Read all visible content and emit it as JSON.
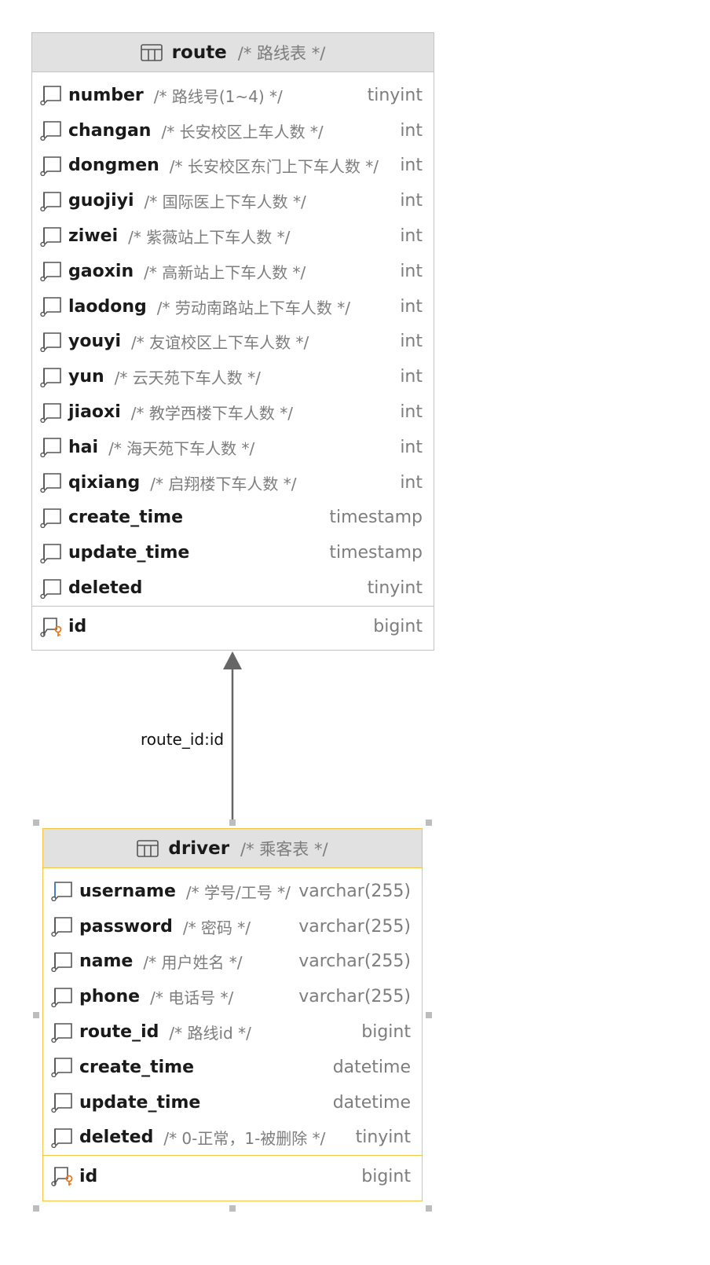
{
  "route": {
    "name": "route",
    "comment": "/* 路线表 */",
    "columns": [
      {
        "name": "number",
        "comment": "/* 路线号(1~4) */",
        "type": "tinyint"
      },
      {
        "name": "changan",
        "comment": "/* 长安校区上车人数 */",
        "type": "int"
      },
      {
        "name": "dongmen",
        "comment": "/* 长安校区东门上下车人数 */",
        "type": "int"
      },
      {
        "name": "guojiyi",
        "comment": "/* 国际医上下车人数 */",
        "type": "int"
      },
      {
        "name": "ziwei",
        "comment": "/* 紫薇站上下车人数 */",
        "type": "int"
      },
      {
        "name": "gaoxin",
        "comment": "/* 高新站上下车人数 */",
        "type": "int"
      },
      {
        "name": "laodong",
        "comment": "/* 劳动南路站上下车人数 */",
        "type": "int"
      },
      {
        "name": "youyi",
        "comment": "/* 友谊校区上下车人数 */",
        "type": "int"
      },
      {
        "name": "yun",
        "comment": "/* 云天苑下车人数 */",
        "type": "int"
      },
      {
        "name": "jiaoxi",
        "comment": "/* 教学西楼下车人数 */",
        "type": "int"
      },
      {
        "name": "hai",
        "comment": "/* 海天苑下车人数 */",
        "type": "int"
      },
      {
        "name": "qixiang",
        "comment": "/* 启翔楼下车人数 */",
        "type": "int"
      },
      {
        "name": "create_time",
        "comment": "",
        "type": "timestamp"
      },
      {
        "name": "update_time",
        "comment": "",
        "type": "timestamp"
      },
      {
        "name": "deleted",
        "comment": "",
        "type": "tinyint"
      }
    ],
    "pk": {
      "name": "id",
      "type": "bigint"
    }
  },
  "driver": {
    "name": "driver",
    "comment": "/* 乘客表 */",
    "columns": [
      {
        "name": "username",
        "comment": "/* 学号/工号 */",
        "type": "varchar(255)"
      },
      {
        "name": "password",
        "comment": "/* 密码 */",
        "type": "varchar(255)"
      },
      {
        "name": "name",
        "comment": "/* 用户姓名 */",
        "type": "varchar(255)"
      },
      {
        "name": "phone",
        "comment": "/* 电话号 */",
        "type": "varchar(255)"
      },
      {
        "name": "route_id",
        "comment": "/* 路线id */",
        "type": "bigint"
      },
      {
        "name": "create_time",
        "comment": "",
        "type": "datetime"
      },
      {
        "name": "update_time",
        "comment": "",
        "type": "datetime"
      },
      {
        "name": "deleted",
        "comment": "/* 0-正常，1-被删除 */",
        "type": "tinyint"
      }
    ],
    "pk": {
      "name": "id",
      "type": "bigint"
    }
  },
  "relation": {
    "label": "route_id:id"
  },
  "colors": {
    "header_bg": "#e1e1e1",
    "selected_border": "#f5c542",
    "key_icon": "#e87a1e",
    "unique_icon": "#3a7bd5"
  },
  "icons": {
    "table": "table-grid-icon",
    "column": "column-icon",
    "primary_key": "primary-key-icon",
    "unique_column": "unique-column-icon"
  }
}
